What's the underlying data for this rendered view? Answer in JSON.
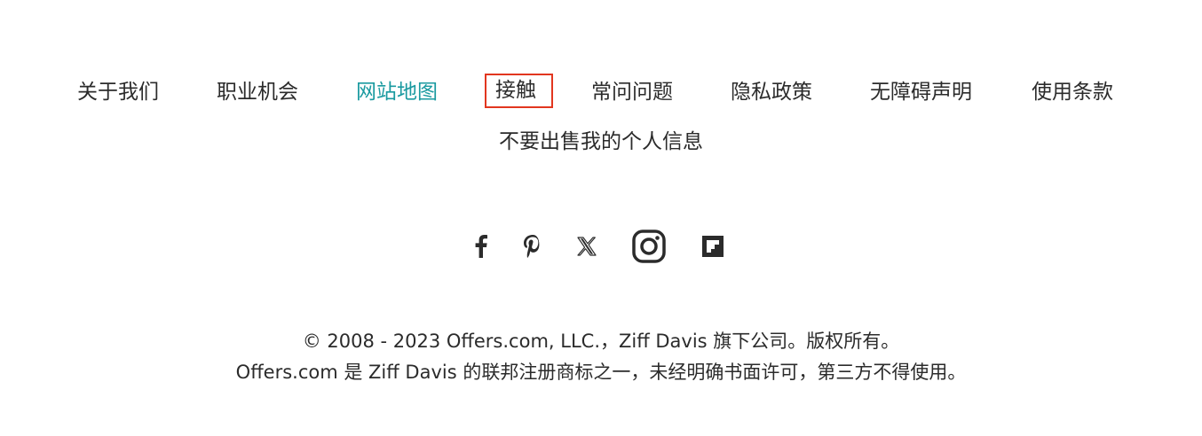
{
  "footer_nav": {
    "links": [
      {
        "label": "关于我们"
      },
      {
        "label": "职业机会"
      },
      {
        "label": "网站地图"
      },
      {
        "label": "接触"
      },
      {
        "label": "常问问题"
      },
      {
        "label": "隐私政策"
      },
      {
        "label": "无障碍声明"
      },
      {
        "label": "使用条款"
      }
    ],
    "do_not_sell": "不要出售我的个人信息"
  },
  "social": {
    "icons": [
      "facebook-icon",
      "pinterest-icon",
      "x-twitter-icon",
      "instagram-icon",
      "flipboard-icon"
    ]
  },
  "copyright": {
    "line1": "© 2008 - 2023 Offers.com, LLC.，Ziff Davis 旗下公司。版权所有。",
    "line2": "Offers.com 是 Ziff Davis 的联邦注册商标之一，未经明确书面许可，第三方不得使用。"
  },
  "colors": {
    "text": "#2b2b2b",
    "active_link": "#1a9aa0",
    "highlight_border": "#e2361f"
  }
}
